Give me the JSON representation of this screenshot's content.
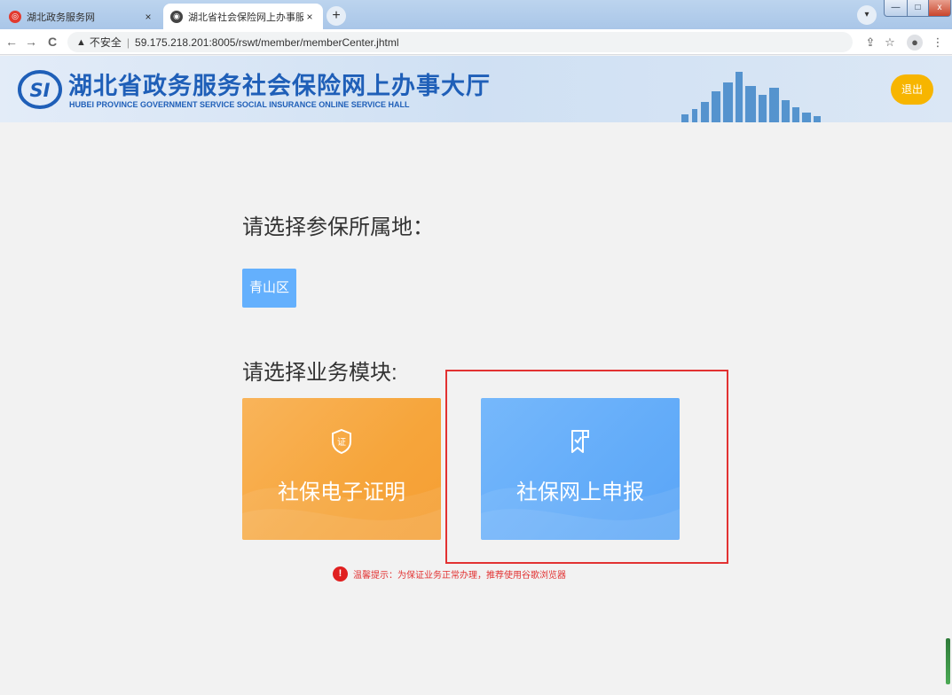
{
  "browser": {
    "tabs": [
      {
        "title": "湖北政务服务网",
        "favicon": "gov-favicon-icon",
        "active": false
      },
      {
        "title": "湖北省社会保险网上办事服务大厅",
        "favicon": "globe-icon",
        "active": true
      }
    ],
    "tab_close": "×",
    "new_tab": "+",
    "address": {
      "security_label": "不安全",
      "url": "59.175.218.201:8005/rswt/member/memberCenter.jhtml"
    },
    "window_controls": {
      "minimize": "—",
      "maximize": "□",
      "close": "x"
    }
  },
  "header": {
    "logo_text": "SI",
    "title": "湖北省政务服务社会保险网上办事大厅",
    "subtitle": "HUBEI PROVINCE GOVERNMENT SERVICE SOCIAL INSURANCE ONLINE SERVICE HALL",
    "logout_label": "退出"
  },
  "main": {
    "region_heading": "请选择参保所属地：",
    "region_option": "青山区",
    "module_heading": "请选择业务模块:",
    "modules": [
      {
        "label": "社保电子证明",
        "icon": "shield-certificate-icon",
        "color": "#f6a53b"
      },
      {
        "label": "社保网上申报",
        "icon": "document-check-icon",
        "color": "#63acf9"
      }
    ],
    "notice": "温馨提示：为保证业务正常办理，推荐使用谷歌浏览器"
  },
  "colors": {
    "brand_blue": "#1f5fb8",
    "logout_yellow": "#f7b500",
    "highlight_red": "#e23232"
  }
}
